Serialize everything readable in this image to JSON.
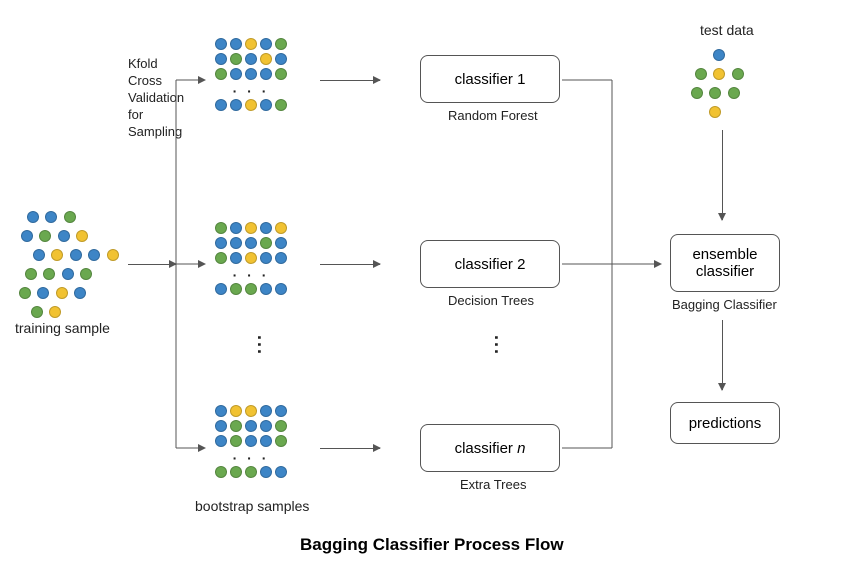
{
  "title": "Bagging Classifier Process Flow",
  "training_sample_label": "training sample",
  "kfold_label": "Kfold\nCross\nValidation\nfor\nSampling",
  "bootstrap_label": "bootstrap  samples",
  "classifiers": [
    {
      "box": "classifier 1",
      "sub": "Random Forest"
    },
    {
      "box": "classifier 2",
      "sub": "Decision Trees"
    },
    {
      "box": "classifier n",
      "sub": "Extra Trees"
    }
  ],
  "test_data_label": "test data",
  "ensemble_box": "ensemble\nclassifier",
  "ensemble_sub": "Bagging Classifier",
  "predictions_box": "predictions",
  "dots": "· · ·"
}
